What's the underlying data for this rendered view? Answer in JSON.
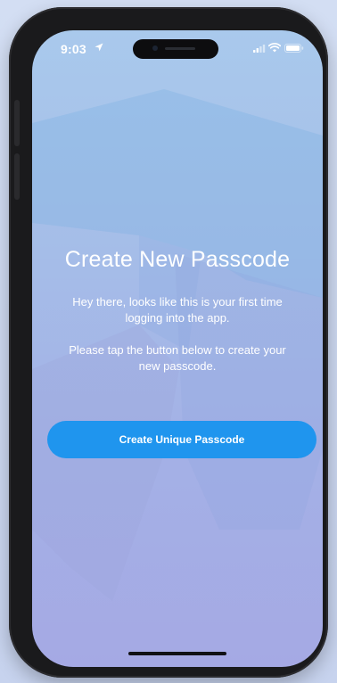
{
  "status_bar": {
    "time": "9:03",
    "icons": [
      "location-arrow-icon",
      "signal-icon",
      "wifi-icon",
      "battery-icon"
    ]
  },
  "screen": {
    "title": "Create New Passcode",
    "intro_text": "Hey there, looks like this is your first time logging into the app.",
    "instruction_text": "Please tap the button below to create your new passcode.",
    "cta_label": "Create Unique Passcode"
  },
  "colors": {
    "screen_gradient_top": "#a9c9ec",
    "screen_gradient_bottom": "#a5a9e4",
    "cta_background": "#1f95ee",
    "text": "#ffffff",
    "device_frame": "#1a1a1c"
  }
}
